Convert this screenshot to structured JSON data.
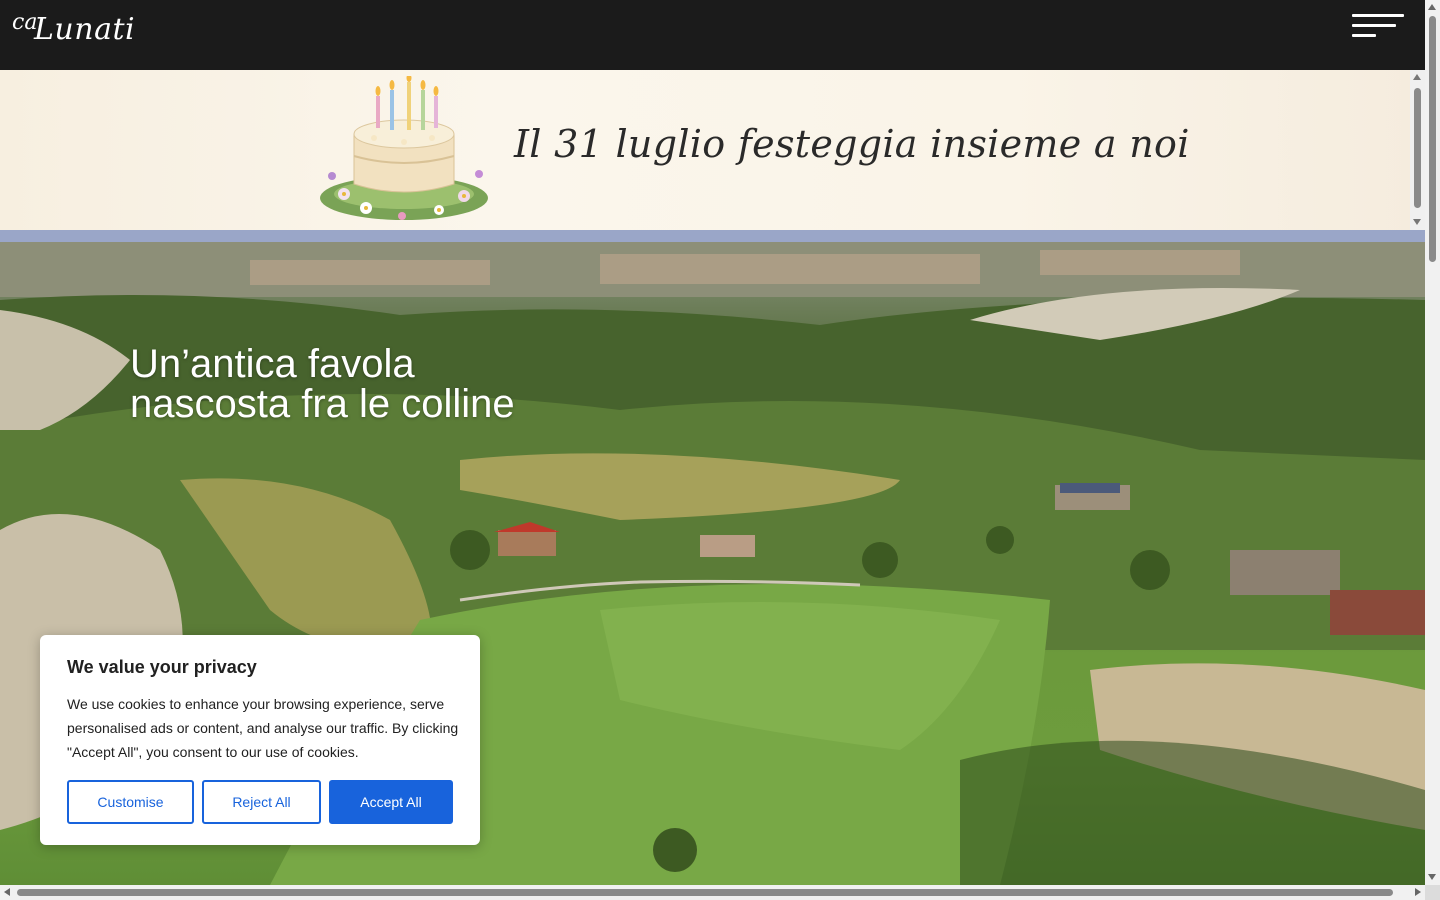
{
  "header": {
    "logo_prefix": "ca",
    "logo_name": "Lunati",
    "menu_icon": "hamburger-menu-icon"
  },
  "banner": {
    "text": "Il 31 luglio festeggia insieme a noi",
    "image": "birthday-cake-illustration"
  },
  "hero": {
    "title_line1": "Un’antica favola",
    "title_line2": "nascosta fra le colline",
    "background": "aerial-hills-landscape"
  },
  "cookie_banner": {
    "title": "We value your privacy",
    "text": "We use cookies to enhance your browsing experience, serve personalised ads or content, and analyse our traffic. By clicking \"Accept All\", you consent to our use of cookies.",
    "customise_label": "Customise",
    "reject_label": "Reject All",
    "accept_label": "Accept All",
    "accent_color": "#1863dc"
  }
}
